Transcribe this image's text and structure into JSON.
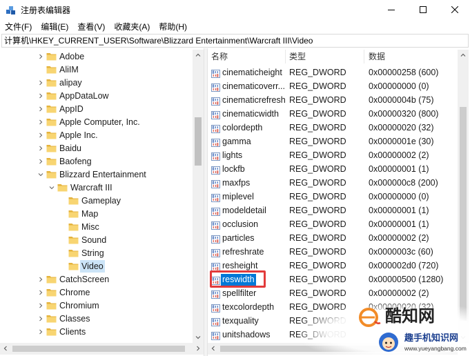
{
  "window": {
    "title": "注册表编辑器"
  },
  "menu": [
    {
      "label": "文件(F)"
    },
    {
      "label": "编辑(E)"
    },
    {
      "label": "查看(V)"
    },
    {
      "label": "收藏夹(A)"
    },
    {
      "label": "帮助(H)"
    }
  ],
  "address": {
    "path": "计算机\\HKEY_CURRENT_USER\\Software\\Blizzard Entertainment\\Warcraft III\\Video"
  },
  "tree": [
    {
      "label": "Adobe",
      "depth": 1,
      "has_children": true,
      "expanded": false
    },
    {
      "label": "AliIM",
      "depth": 1,
      "has_children": false,
      "expanded": false
    },
    {
      "label": "alipay",
      "depth": 1,
      "has_children": true,
      "expanded": false
    },
    {
      "label": "AppDataLow",
      "depth": 1,
      "has_children": true,
      "expanded": false
    },
    {
      "label": "AppID",
      "depth": 1,
      "has_children": true,
      "expanded": false
    },
    {
      "label": "Apple Computer, Inc.",
      "depth": 1,
      "has_children": true,
      "expanded": false
    },
    {
      "label": "Apple Inc.",
      "depth": 1,
      "has_children": true,
      "expanded": false
    },
    {
      "label": "Baidu",
      "depth": 1,
      "has_children": true,
      "expanded": false
    },
    {
      "label": "Baofeng",
      "depth": 1,
      "has_children": true,
      "expanded": false
    },
    {
      "label": "Blizzard Entertainment",
      "depth": 1,
      "has_children": true,
      "expanded": true
    },
    {
      "label": "Warcraft III",
      "depth": 2,
      "has_children": true,
      "expanded": true
    },
    {
      "label": "Gameplay",
      "depth": 3,
      "has_children": false
    },
    {
      "label": "Map",
      "depth": 3,
      "has_children": false
    },
    {
      "label": "Misc",
      "depth": 3,
      "has_children": false
    },
    {
      "label": "Sound",
      "depth": 3,
      "has_children": false
    },
    {
      "label": "String",
      "depth": 3,
      "has_children": false
    },
    {
      "label": "Video",
      "depth": 3,
      "has_children": false,
      "selected": true
    },
    {
      "label": "CatchScreen",
      "depth": 1,
      "has_children": true,
      "expanded": false
    },
    {
      "label": "Chrome",
      "depth": 1,
      "has_children": true,
      "expanded": false
    },
    {
      "label": "Chromium",
      "depth": 1,
      "has_children": true,
      "expanded": false
    },
    {
      "label": "Classes",
      "depth": 1,
      "has_children": true,
      "expanded": false
    },
    {
      "label": "Clients",
      "depth": 1,
      "has_children": true,
      "expanded": false
    }
  ],
  "list": {
    "columns": {
      "name": "名称",
      "type": "类型",
      "data": "数据"
    },
    "values": [
      {
        "name": "cinematicheight",
        "type": "REG_DWORD",
        "data": "0x00000258 (600)"
      },
      {
        "name": "cinematicoverr...",
        "type": "REG_DWORD",
        "data": "0x00000000 (0)"
      },
      {
        "name": "cinematicrefresh",
        "type": "REG_DWORD",
        "data": "0x0000004b (75)"
      },
      {
        "name": "cinematicwidth",
        "type": "REG_DWORD",
        "data": "0x00000320 (800)"
      },
      {
        "name": "colordepth",
        "type": "REG_DWORD",
        "data": "0x00000020 (32)"
      },
      {
        "name": "gamma",
        "type": "REG_DWORD",
        "data": "0x0000001e (30)"
      },
      {
        "name": "lights",
        "type": "REG_DWORD",
        "data": "0x00000002 (2)"
      },
      {
        "name": "lockfb",
        "type": "REG_DWORD",
        "data": "0x00000001 (1)"
      },
      {
        "name": "maxfps",
        "type": "REG_DWORD",
        "data": "0x000000c8 (200)"
      },
      {
        "name": "miplevel",
        "type": "REG_DWORD",
        "data": "0x00000000 (0)"
      },
      {
        "name": "modeldetail",
        "type": "REG_DWORD",
        "data": "0x00000001 (1)"
      },
      {
        "name": "occlusion",
        "type": "REG_DWORD",
        "data": "0x00000001 (1)"
      },
      {
        "name": "particles",
        "type": "REG_DWORD",
        "data": "0x00000002 (2)"
      },
      {
        "name": "refreshrate",
        "type": "REG_DWORD",
        "data": "0x0000003c (60)"
      },
      {
        "name": "resheight",
        "type": "REG_DWORD",
        "data": "0x000002d0 (720)"
      },
      {
        "name": "reswidth",
        "type": "REG_DWORD",
        "data": "0x00000500 (1280)",
        "selected": true,
        "annotated": true
      },
      {
        "name": "spellfilter",
        "type": "REG_DWORD",
        "data": "0x00000002 (2)"
      },
      {
        "name": "texcolordepth",
        "type": "REG_DWORD",
        "data": "0x00000020 (32)"
      },
      {
        "name": "texquality",
        "type": "REG_DWORD",
        "data": ""
      },
      {
        "name": "unitshadows",
        "type": "REG_DWORD",
        "data": ""
      }
    ]
  },
  "watermark": {
    "brand": "酷知网",
    "site": "趣手机知识网",
    "url": "www.yueyangbang.com"
  },
  "icons": {
    "app": "registry-editor-icon",
    "minimize": "minimize-icon",
    "maximize": "maximize-icon",
    "close": "close-icon",
    "folder": "folder-icon",
    "expand": "chevron-right-icon",
    "collapse": "chevron-down-icon",
    "value": "reg-dword-icon"
  },
  "colors": {
    "selection": "#0078d7",
    "tree_selected": "#cce4f7",
    "highlight_box": "#e23b3b",
    "folder_body": "#f8d572",
    "folder_tab": "#e4b23c"
  }
}
